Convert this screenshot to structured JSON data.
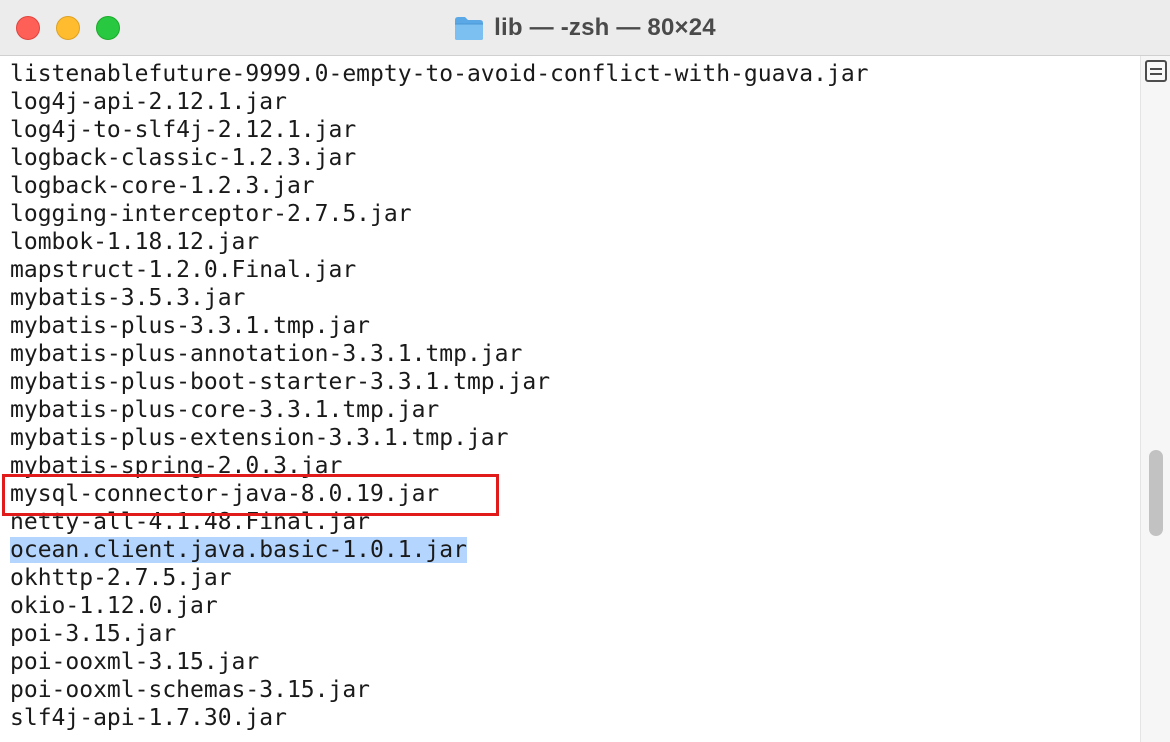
{
  "window": {
    "title": "lib — -zsh — 80×24",
    "title_icon": "folder-icon",
    "traffic_lights": {
      "close_color": "#fe5f57",
      "minimize_color": "#febc2e",
      "zoom_color": "#28c840"
    }
  },
  "terminal": {
    "lines": [
      "listenablefuture-9999.0-empty-to-avoid-conflict-with-guava.jar",
      "log4j-api-2.12.1.jar",
      "log4j-to-slf4j-2.12.1.jar",
      "logback-classic-1.2.3.jar",
      "logback-core-1.2.3.jar",
      "logging-interceptor-2.7.5.jar",
      "lombok-1.18.12.jar",
      "mapstruct-1.2.0.Final.jar",
      "mybatis-3.5.3.jar",
      "mybatis-plus-3.3.1.tmp.jar",
      "mybatis-plus-annotation-3.3.1.tmp.jar",
      "mybatis-plus-boot-starter-3.3.1.tmp.jar",
      "mybatis-plus-core-3.3.1.tmp.jar",
      "mybatis-plus-extension-3.3.1.tmp.jar",
      "mybatis-spring-2.0.3.jar",
      "mysql-connector-java-8.0.19.jar",
      "netty-all-4.1.48.Final.jar",
      "ocean.client.java.basic-1.0.1.jar",
      "okhttp-2.7.5.jar",
      "okio-1.12.0.jar",
      "poi-3.15.jar",
      "poi-ooxml-3.15.jar",
      "poi-ooxml-schemas-3.15.jar",
      "slf4j-api-1.7.30.jar"
    ],
    "selected_line": "ocean.client.java.basic-1.0.1.jar",
    "selection_color": "#b4d5fd",
    "annotation_color": "#e11a1a"
  },
  "scrollbar": {
    "icon": "list-icon"
  }
}
